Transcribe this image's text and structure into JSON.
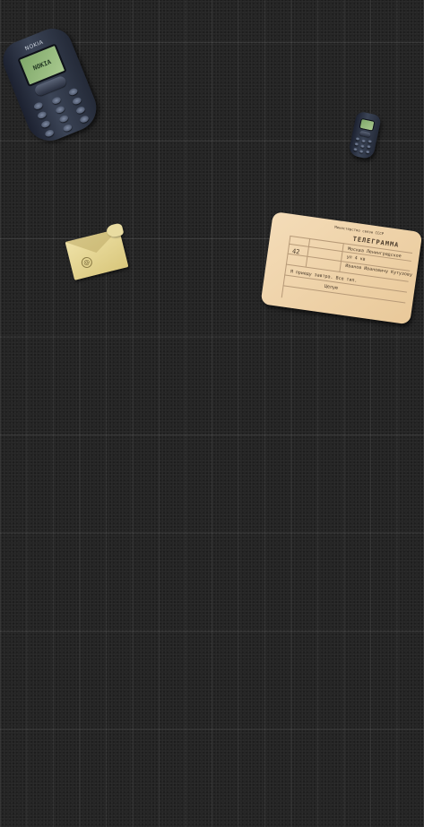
{
  "phone_large": {
    "brand": "NOKIA",
    "screen_text": "NOKIA"
  },
  "telegram": {
    "header_small": "Министерство связи СССР",
    "title": "ТЕЛЕГРАММА",
    "number": "42",
    "recipient_lines": [
      "Москва Ленинградское",
      "ул 4 кв",
      "Иванов Ивановичу Кутузову"
    ],
    "message_lines": [
      "Я приеду завтра. Все тип.",
      "Целую"
    ]
  },
  "envelope": {
    "stamp_symbol": "@"
  },
  "colors": {
    "background": "#242424",
    "grid_line": "#3a3a3a",
    "paper": "#f1d8b3",
    "envelope": "#e4d48f",
    "phone_body": "#2f3646",
    "phone_screen": "#93b87c"
  }
}
